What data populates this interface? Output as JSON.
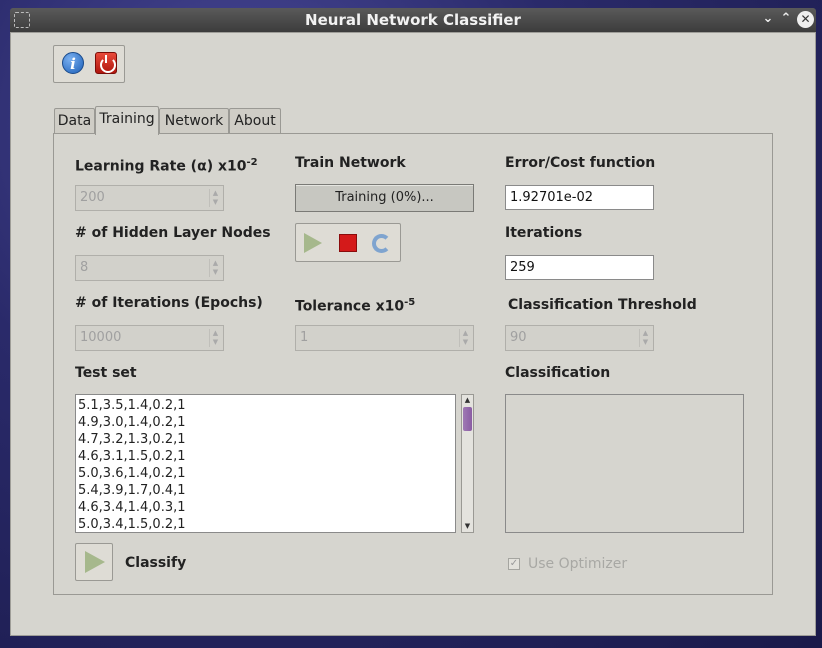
{
  "window": {
    "title": "Neural Network Classifier"
  },
  "tabs": [
    "Data",
    "Training",
    "Network",
    "About"
  ],
  "active_tab": "Training",
  "learning_rate": {
    "label": "Learning Rate (α) x10",
    "exp": "-2",
    "value": "200"
  },
  "hidden_nodes": {
    "label": "# of Hidden Layer Nodes",
    "value": "8"
  },
  "iterations_epochs": {
    "label": "# of Iterations (Epochs)",
    "value": "10000"
  },
  "train_network": {
    "label": "Train Network",
    "progress_text": "Training (0%)..."
  },
  "tolerance": {
    "label": "Tolerance x10",
    "exp": "-5",
    "value": "1"
  },
  "error_cost": {
    "label": "Error/Cost function",
    "value": "1.92701e-02"
  },
  "iterations": {
    "label": "Iterations",
    "value": "259"
  },
  "classification_threshold": {
    "label": "Classification Threshold",
    "value": "90"
  },
  "test_set": {
    "label": "Test set",
    "rows": [
      "5.1,3.5,1.4,0.2,1",
      "4.9,3.0,1.4,0.2,1",
      "4.7,3.2,1.3,0.2,1",
      "4.6,3.1,1.5,0.2,1",
      "5.0,3.6,1.4,0.2,1",
      "5.4,3.9,1.7,0.4,1",
      "4.6,3.4,1.4,0.3,1",
      "5.0,3.4,1.5,0.2,1"
    ]
  },
  "classification": {
    "label": "Classification"
  },
  "classify": {
    "label": "Classify"
  },
  "optimizer": {
    "label": "Use Optimizer",
    "checked": true
  },
  "icons": {
    "info": "info-icon",
    "power": "power-icon",
    "play": "play-icon",
    "stop": "stop-icon",
    "reset": "reset-icon"
  },
  "colors": {
    "window_bg": "#d6d5cf",
    "titlebar": "#3c3c3c",
    "stop": "#d41a1a",
    "scroll_thumb": "#8a5ca3"
  }
}
